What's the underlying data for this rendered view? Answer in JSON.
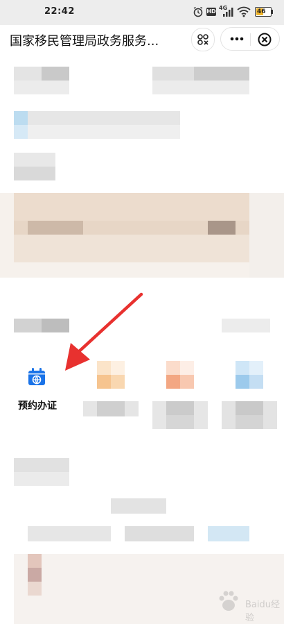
{
  "status_bar": {
    "time": "22:42",
    "network_badge": "HD",
    "signal_label": "4G",
    "battery_level": "46",
    "icons": [
      "alarm-icon",
      "hd-icon",
      "signal-icon",
      "wifi-icon",
      "battery-icon"
    ]
  },
  "nav": {
    "title": "国家移民管理局政务服务...",
    "icons": [
      "scan-icon",
      "more-icon",
      "close-icon"
    ]
  },
  "service": {
    "label": "预约办证",
    "icon": "calendar-globe-icon",
    "accent": "#1a73e8"
  },
  "annotation": {
    "arrow_color": "#e8312f"
  },
  "watermark": {
    "text": "Baidu经验"
  }
}
